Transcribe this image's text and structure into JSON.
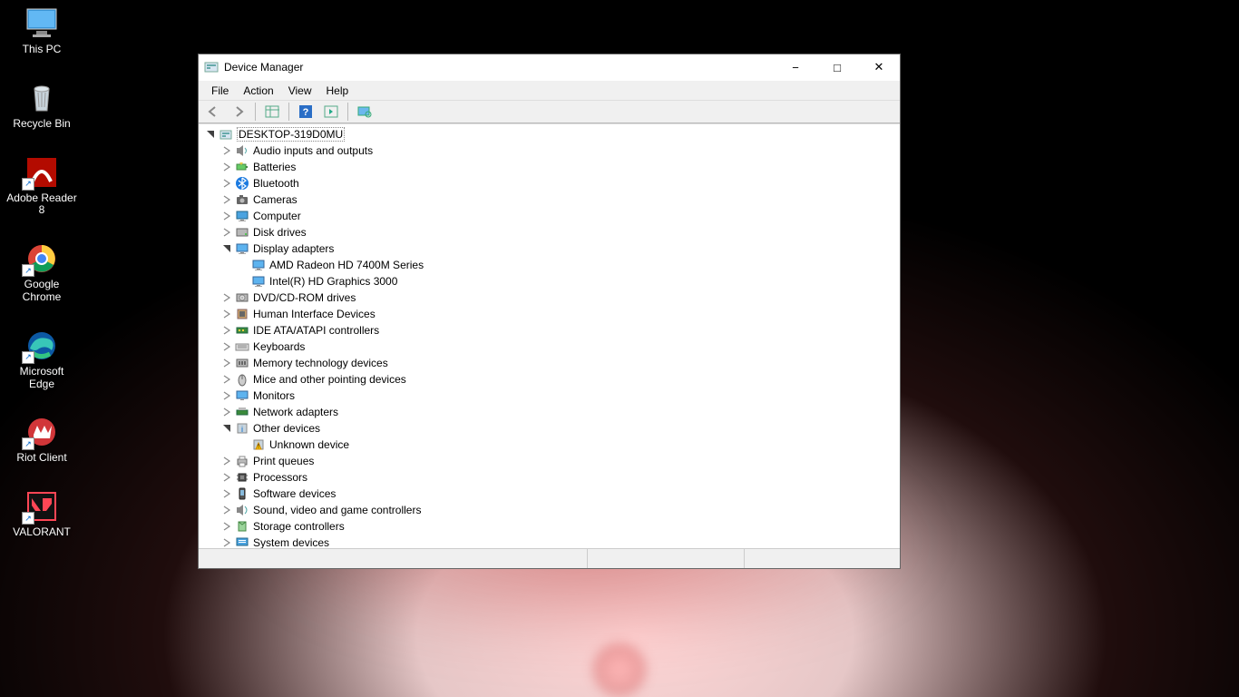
{
  "desktop_icons": [
    {
      "key": "this-pc",
      "label": "This PC"
    },
    {
      "key": "recycle-bin",
      "label": "Recycle Bin"
    },
    {
      "key": "adobe-reader",
      "label": "Adobe Reader 8"
    },
    {
      "key": "google-chrome",
      "label": "Google Chrome"
    },
    {
      "key": "microsoft-edge",
      "label": "Microsoft Edge"
    },
    {
      "key": "riot-client",
      "label": "Riot Client"
    },
    {
      "key": "valorant",
      "label": "VALORANT"
    }
  ],
  "window": {
    "title": "Device Manager",
    "menu": {
      "file": "File",
      "action": "Action",
      "view": "View",
      "help": "Help"
    },
    "controls": {
      "minimize": "−",
      "maximize": "□",
      "close": "✕"
    }
  },
  "tree": {
    "root": "DESKTOP-319D0MU",
    "nodes": [
      {
        "label": "Audio inputs and outputs",
        "icon": "audio-icon",
        "expanded": false
      },
      {
        "label": "Batteries",
        "icon": "battery-icon",
        "expanded": false
      },
      {
        "label": "Bluetooth",
        "icon": "bluetooth-icon",
        "expanded": false
      },
      {
        "label": "Cameras",
        "icon": "camera-icon",
        "expanded": false
      },
      {
        "label": "Computer",
        "icon": "computer-icon",
        "expanded": false
      },
      {
        "label": "Disk drives",
        "icon": "disk-icon",
        "expanded": false
      },
      {
        "label": "Display adapters",
        "icon": "display-icon",
        "expanded": true,
        "children": [
          {
            "label": "AMD Radeon HD 7400M Series",
            "icon": "display-icon"
          },
          {
            "label": "Intel(R) HD Graphics 3000",
            "icon": "display-icon"
          }
        ]
      },
      {
        "label": "DVD/CD-ROM drives",
        "icon": "dvd-icon",
        "expanded": false
      },
      {
        "label": "Human Interface Devices",
        "icon": "hid-icon",
        "expanded": false
      },
      {
        "label": "IDE ATA/ATAPI controllers",
        "icon": "ide-icon",
        "expanded": false
      },
      {
        "label": "Keyboards",
        "icon": "keyboard-icon",
        "expanded": false
      },
      {
        "label": "Memory technology devices",
        "icon": "memory-icon",
        "expanded": false
      },
      {
        "label": "Mice and other pointing devices",
        "icon": "mouse-icon",
        "expanded": false
      },
      {
        "label": "Monitors",
        "icon": "monitor-icon",
        "expanded": false
      },
      {
        "label": "Network adapters",
        "icon": "network-icon",
        "expanded": false
      },
      {
        "label": "Other devices",
        "icon": "other-icon",
        "expanded": true,
        "children": [
          {
            "label": "Unknown device",
            "icon": "warning-icon"
          }
        ]
      },
      {
        "label": "Print queues",
        "icon": "printer-icon",
        "expanded": false
      },
      {
        "label": "Processors",
        "icon": "cpu-icon",
        "expanded": false
      },
      {
        "label": "Software devices",
        "icon": "software-icon",
        "expanded": false
      },
      {
        "label": "Sound, video and game controllers",
        "icon": "sound-icon",
        "expanded": false
      },
      {
        "label": "Storage controllers",
        "icon": "storage-icon",
        "expanded": false
      },
      {
        "label": "System devices",
        "icon": "system-icon",
        "expanded": false
      }
    ]
  }
}
